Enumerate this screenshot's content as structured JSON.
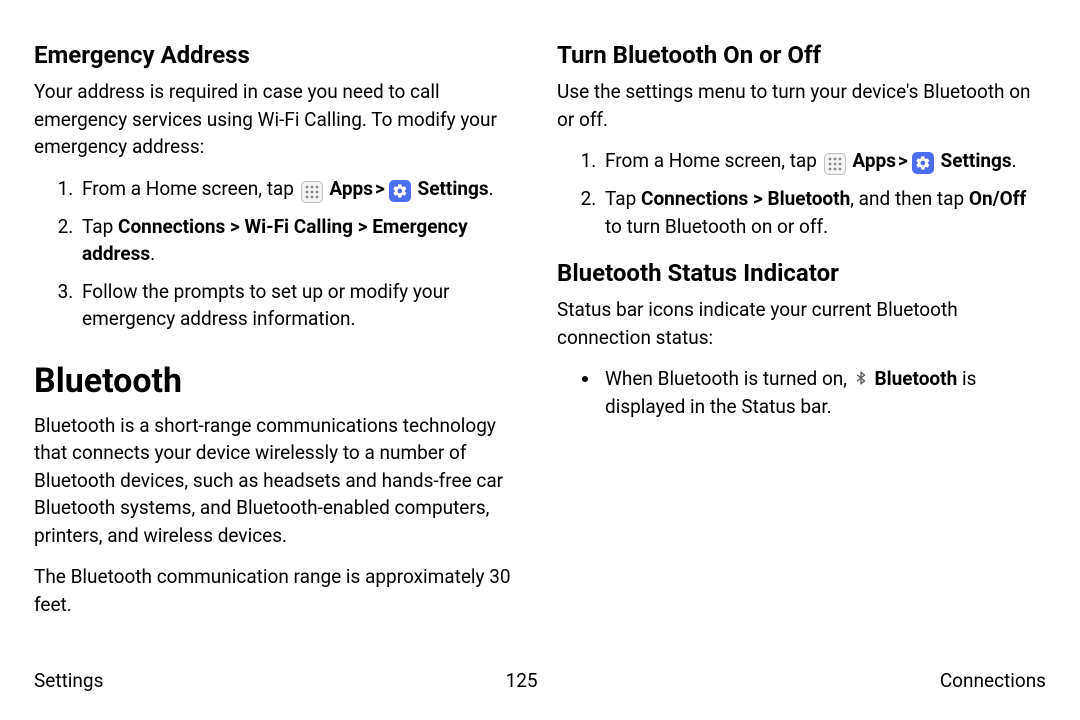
{
  "left": {
    "emergency": {
      "heading": "Emergency Address",
      "intro": "Your address is required in case you need to call emergency services using Wi-Fi Calling. To modify your emergency address:",
      "step1_prefix": "From a Home screen, tap ",
      "apps_label": "Apps",
      "settings_label": "Settings",
      "step2_prefix": "Tap ",
      "step2_bold": "Connections > Wi-Fi Calling > Emergency address",
      "step2_suffix": ".",
      "step3": "Follow the prompts to set up or modify your emergency address information."
    },
    "bluetooth": {
      "heading": "Bluetooth",
      "para1": "Bluetooth is a short-range communications technology that connects your device wirelessly to a number of Bluetooth devices, such as headsets and hands-free car Bluetooth systems, and Bluetooth-enabled computers, printers, and wireless devices.",
      "para2": "The Bluetooth communication range is approximately 30 feet."
    }
  },
  "right": {
    "turn": {
      "heading": "Turn Bluetooth On or Off",
      "intro": "Use the settings menu to turn your device's Bluetooth on or off.",
      "step1_prefix": "From a Home screen, tap ",
      "apps_label": "Apps",
      "settings_label": "Settings",
      "step2_a": "Tap ",
      "step2_b1": "Connections > Bluetooth",
      "step2_c": ", and then tap ",
      "step2_b2": "On/Off",
      "step2_d": " to turn Bluetooth on or off."
    },
    "status": {
      "heading": "Bluetooth Status Indicator",
      "intro": "Status bar icons indicate your current Bluetooth connection status:",
      "bullet_prefix": "When Bluetooth is turned on, ",
      "bullet_bold": "Bluetooth",
      "bullet_suffix": " is displayed in the Status bar."
    }
  },
  "footer": {
    "left": "Settings",
    "center": "125",
    "right": "Connections"
  },
  "glyphs": {
    "chevron": ">"
  }
}
